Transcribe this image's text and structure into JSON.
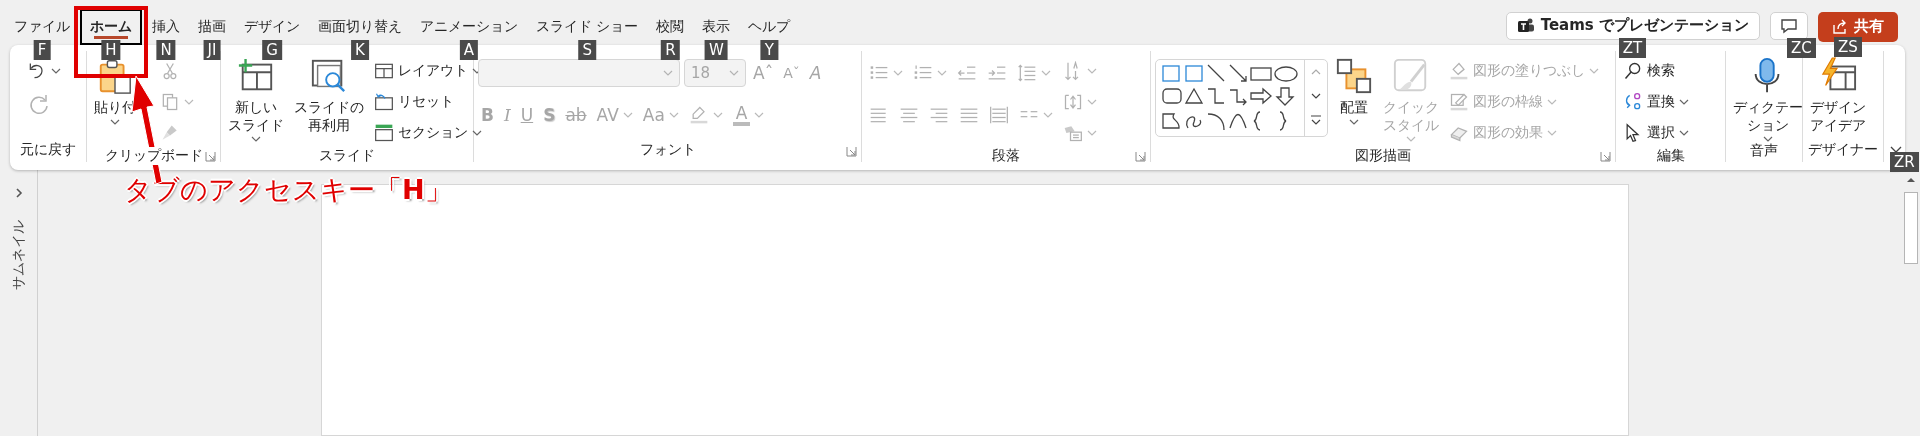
{
  "tabs": [
    {
      "label": "ファイル",
      "selected": false,
      "key_tip": "F"
    },
    {
      "label": "ホーム",
      "selected": true,
      "key_tip": "H"
    },
    {
      "label": "挿入",
      "selected": false,
      "key_tip": "N"
    },
    {
      "label": "描画",
      "selected": false,
      "key_tip": "JI"
    },
    {
      "label": "デザイン",
      "selected": false,
      "key_tip": "G"
    },
    {
      "label": "画面切り替え",
      "selected": false,
      "key_tip": "K"
    },
    {
      "label": "アニメーション",
      "selected": false,
      "key_tip": "A"
    },
    {
      "label": "スライド ショー",
      "selected": false,
      "key_tip": "S"
    },
    {
      "label": "校閲",
      "selected": false,
      "key_tip": "R"
    },
    {
      "label": "表示",
      "selected": false,
      "key_tip": "W"
    },
    {
      "label": "ヘルプ",
      "selected": false,
      "key_tip": "Y"
    }
  ],
  "header_actions": {
    "teams": {
      "label": "Teams でプレゼンテーション",
      "key_tip": "ZT"
    },
    "comments": {
      "key_tip": "ZC"
    },
    "share": {
      "label": "共有",
      "key_tip": "ZS"
    }
  },
  "ribbon": {
    "collapse_key_tip": "ZR",
    "groups": [
      {
        "label": "元に戻す",
        "launcher": false,
        "sections": [
          {
            "kind": "stack",
            "rows": [
              [
                {
                  "kind": "tool",
                  "disabled": false,
                  "dropdown": true
                }
              ],
              [
                {
                  "kind": "tool",
                  "disabled": true,
                  "dropdown": false
                }
              ]
            ]
          }
        ]
      },
      {
        "label": "クリップボード",
        "launcher": true,
        "sections": [
          {
            "kind": "large",
            "label": [
              "貼り付"
            ],
            "disabled": false,
            "dropdown": true
          },
          {
            "kind": "stack",
            "rows": [
              [
                {
                  "kind": "tool",
                  "disabled": true,
                  "dropdown": false
                }
              ],
              [
                {
                  "kind": "tool",
                  "disabled": true,
                  "dropdown": true
                }
              ],
              [
                {
                  "kind": "tool",
                  "disabled": true,
                  "dropdown": false
                }
              ]
            ]
          }
        ]
      },
      {
        "label": "スライド",
        "launcher": false,
        "sections": [
          {
            "kind": "large",
            "label": [
              "新しい",
              "スライド"
            ],
            "disabled": false,
            "dropdown": true
          },
          {
            "kind": "large",
            "label": [
              "スライドの",
              "再利用"
            ],
            "disabled": false,
            "dropdown": false
          },
          {
            "kind": "stack",
            "rows": [
              [
                {
                  "kind": "tool",
                  "label": "レイアウト",
                  "disabled": false,
                  "dropdown": true
                }
              ],
              [
                {
                  "kind": "tool",
                  "label": "リセット",
                  "disabled": false,
                  "dropdown": false
                }
              ],
              [
                {
                  "kind": "tool",
                  "label": "セクション",
                  "disabled": false,
                  "dropdown": true
                }
              ]
            ]
          }
        ]
      },
      {
        "label": "フォント",
        "launcher": true,
        "sections": [
          {
            "kind": "stack",
            "rows": [
              [
                {
                  "kind": "combo",
                  "disabled": true,
                  "dropdown": true
                },
                {
                  "kind": "combo",
                  "value": "18",
                  "disabled": true,
                  "dropdown": true
                },
                {
                  "kind": "tool",
                  "glyph": "Aˆ",
                  "disabled": true,
                  "dropdown": false
                },
                {
                  "kind": "tool",
                  "glyph": "Aˇ",
                  "disabled": true,
                  "dropdown": false
                },
                {
                  "kind": "tool",
                  "glyph": "A",
                  "disabled": true,
                  "dropdown": false
                }
              ],
              [
                {
                  "kind": "tool",
                  "glyph": "B",
                  "disabled": true,
                  "dropdown": false
                },
                {
                  "kind": "tool",
                  "glyph": "I",
                  "disabled": true,
                  "dropdown": false
                },
                {
                  "kind": "tool",
                  "glyph": "U",
                  "disabled": true,
                  "dropdown": false
                },
                {
                  "kind": "tool",
                  "glyph": "S",
                  "disabled": true,
                  "dropdown": false
                },
                {
                  "kind": "tool",
                  "glyph": "ab",
                  "disabled": true,
                  "dropdown": false
                },
                {
                  "kind": "tool",
                  "glyph": "AV",
                  "disabled": true,
                  "dropdown": true
                },
                {
                  "kind": "tool",
                  "glyph": "Aa",
                  "disabled": true,
                  "dropdown": true
                },
                {
                  "kind": "tool",
                  "disabled": true,
                  "dropdown": true
                },
                {
                  "kind": "tool",
                  "glyph": "A",
                  "disabled": true,
                  "dropdown": true
                }
              ]
            ]
          }
        ]
      },
      {
        "label": "段落",
        "launcher": true,
        "sections": [
          {
            "kind": "stack",
            "rows": [
              [
                {
                  "kind": "tool",
                  "disabled": true,
                  "dropdown": true
                },
                {
                  "kind": "tool",
                  "disabled": true,
                  "dropdown": true
                },
                {
                  "kind": "tool",
                  "disabled": true,
                  "dropdown": false
                },
                {
                  "kind": "tool",
                  "disabled": true,
                  "dropdown": false
                },
                {
                  "kind": "tool",
                  "disabled": true,
                  "dropdown": true
                }
              ],
              [
                {
                  "kind": "tool",
                  "disabled": true,
                  "dropdown": false
                },
                {
                  "kind": "tool",
                  "disabled": true,
                  "dropdown": false
                },
                {
                  "kind": "tool",
                  "disabled": true,
                  "dropdown": false
                },
                {
                  "kind": "tool",
                  "disabled": true,
                  "dropdown": false
                },
                {
                  "kind": "tool",
                  "disabled": true,
                  "dropdown": false
                },
                {
                  "kind": "tool",
                  "disabled": true,
                  "dropdown": true
                }
              ]
            ]
          },
          {
            "kind": "stack",
            "rows": [
              [
                {
                  "kind": "tool",
                  "disabled": true,
                  "dropdown": true
                }
              ],
              [
                {
                  "kind": "tool",
                  "disabled": true,
                  "dropdown": true
                }
              ],
              [
                {
                  "kind": "tool",
                  "disabled": true,
                  "dropdown": true
                }
              ]
            ]
          }
        ]
      },
      {
        "label": "図形描画",
        "launcher": true,
        "sections": [
          {
            "kind": "gallery"
          },
          {
            "kind": "large",
            "label": [
              "配置"
            ],
            "disabled": false,
            "dropdown": true
          },
          {
            "kind": "large",
            "label": [
              "クイック",
              "スタイル"
            ],
            "disabled": true,
            "dropdown": true
          },
          {
            "kind": "stack",
            "rows": [
              [
                {
                  "kind": "tool",
                  "label": "図形の塗りつぶし",
                  "disabled": true,
                  "dropdown": true
                }
              ],
              [
                {
                  "kind": "tool",
                  "label": "図形の枠線",
                  "disabled": true,
                  "dropdown": true
                }
              ],
              [
                {
                  "kind": "tool",
                  "label": "図形の効果",
                  "disabled": true,
                  "dropdown": true
                }
              ]
            ]
          }
        ]
      },
      {
        "label": "編集",
        "launcher": false,
        "sections": [
          {
            "kind": "stack",
            "rows": [
              [
                {
                  "kind": "tool",
                  "label": "検索",
                  "disabled": false,
                  "dropdown": false
                }
              ],
              [
                {
                  "kind": "tool",
                  "label": "置換",
                  "disabled": false,
                  "dropdown": true
                }
              ],
              [
                {
                  "kind": "tool",
                  "label": "選択",
                  "disabled": false,
                  "dropdown": true
                }
              ]
            ]
          }
        ]
      },
      {
        "label": "音声",
        "launcher": false,
        "sections": [
          {
            "kind": "large",
            "label": [
              "ディクテー",
              "ション"
            ],
            "disabled": false,
            "dropdown": true
          }
        ]
      },
      {
        "label": "デザイナー",
        "launcher": false,
        "sections": [
          {
            "kind": "large",
            "label": [
              "デザイン",
              "アイデア"
            ],
            "disabled": false,
            "dropdown": false
          }
        ]
      }
    ]
  },
  "thumbnail_pane": {
    "label": "サムネイル"
  },
  "annotation": {
    "text": "タブのアクセスキー「**H**」"
  }
}
